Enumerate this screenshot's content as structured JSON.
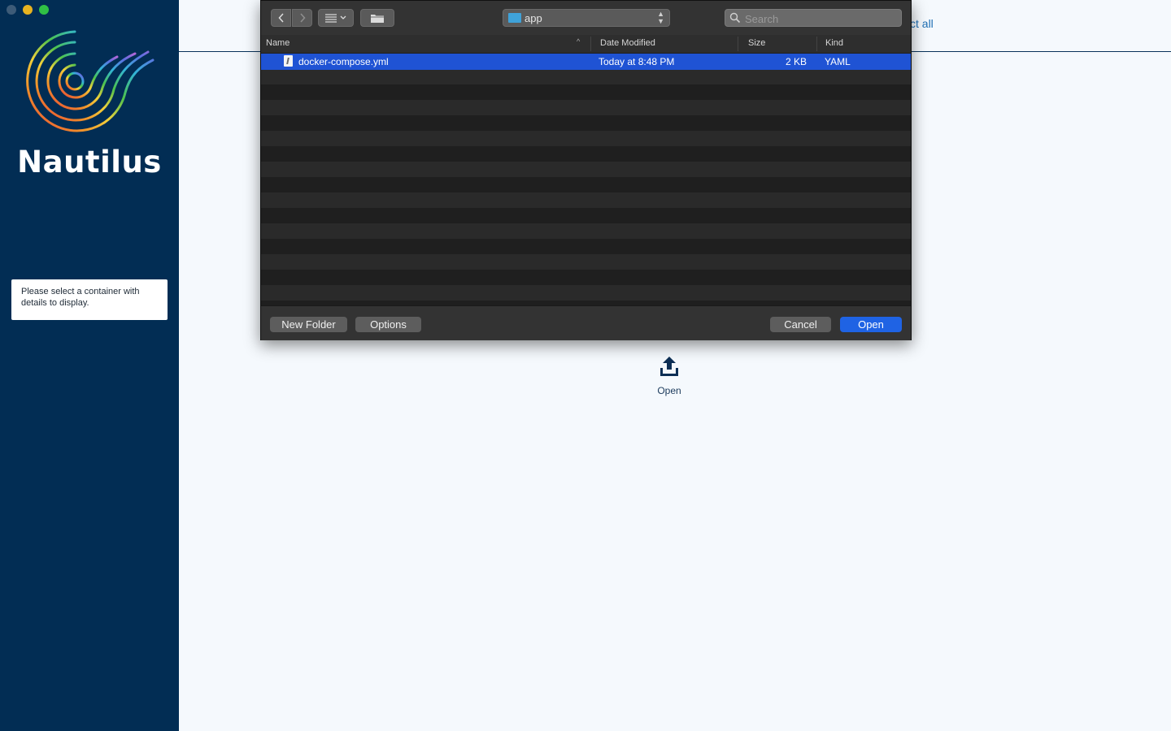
{
  "window": {
    "traffic_lights": [
      "close",
      "minimize",
      "maximize"
    ]
  },
  "sidebar": {
    "brand": "Nautilus",
    "notice": "Please select a container with details to display."
  },
  "header": {
    "select_all_label": "ct all"
  },
  "main": {
    "open_label": "Open",
    "open_icon": "upload-icon"
  },
  "dialog": {
    "toolbar": {
      "back_icon": "chevron-left-icon",
      "forward_icon": "chevron-right-icon",
      "view_icon": "list-view-icon",
      "new_folder_icon": "folder-icon",
      "location": "app",
      "search_placeholder": "Search"
    },
    "columns": {
      "name": "Name",
      "date_modified": "Date Modified",
      "size": "Size",
      "kind": "Kind"
    },
    "files": [
      {
        "name": "docker-compose.yml",
        "date_modified": "Today at 8:48 PM",
        "size": "2 KB",
        "kind": "YAML",
        "selected": true
      }
    ],
    "buttons": {
      "new_folder": "New Folder",
      "options": "Options",
      "cancel": "Cancel",
      "open": "Open"
    }
  },
  "colors": {
    "sidebar_bg": "#022d54",
    "main_bg": "#f5f9fd",
    "selection": "#1f53d4",
    "primary_button": "#1f63e4"
  }
}
